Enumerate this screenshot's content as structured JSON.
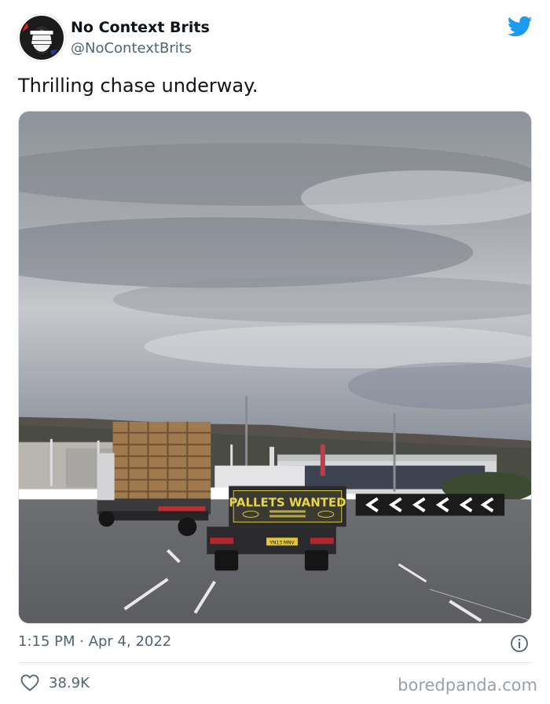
{
  "user": {
    "display_name": "No Context Brits",
    "handle": "@NoContextBrits",
    "avatar_icon": "avatar-punk-portrait"
  },
  "tweet": {
    "text": "Thrilling chase underway.",
    "timestamp": "1:15 PM · Apr 4, 2022",
    "likes": "38.9K"
  },
  "photo": {
    "truck_sign_title": "PALLETS WANTED",
    "plate": "YN13 MNV"
  },
  "icons": {
    "brand": "twitter-bird-icon",
    "info": "info-icon",
    "like": "heart-icon"
  },
  "colors": {
    "twitter_blue": "#1d9bf0",
    "text_primary": "#0f1419",
    "text_secondary": "#536471"
  },
  "watermark": "boredpanda.com"
}
